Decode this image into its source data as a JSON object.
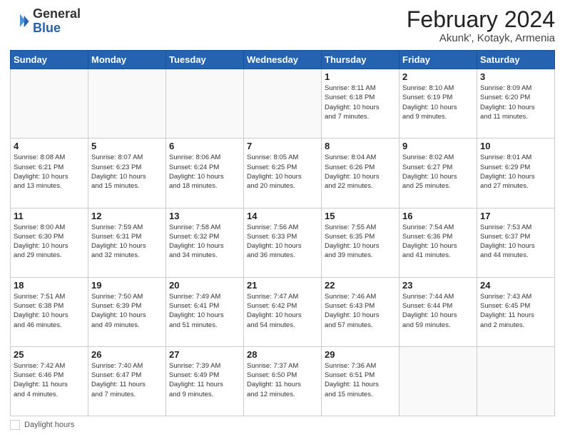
{
  "header": {
    "logo_general": "General",
    "logo_blue": "Blue",
    "month_title": "February 2024",
    "location": "Akunk', Kotayk, Armenia"
  },
  "days_of_week": [
    "Sunday",
    "Monday",
    "Tuesday",
    "Wednesday",
    "Thursday",
    "Friday",
    "Saturday"
  ],
  "footer": {
    "label": "Daylight hours"
  },
  "weeks": [
    [
      {
        "day": "",
        "info": ""
      },
      {
        "day": "",
        "info": ""
      },
      {
        "day": "",
        "info": ""
      },
      {
        "day": "",
        "info": ""
      },
      {
        "day": "1",
        "info": "Sunrise: 8:11 AM\nSunset: 6:18 PM\nDaylight: 10 hours\nand 7 minutes."
      },
      {
        "day": "2",
        "info": "Sunrise: 8:10 AM\nSunset: 6:19 PM\nDaylight: 10 hours\nand 9 minutes."
      },
      {
        "day": "3",
        "info": "Sunrise: 8:09 AM\nSunset: 6:20 PM\nDaylight: 10 hours\nand 11 minutes."
      }
    ],
    [
      {
        "day": "4",
        "info": "Sunrise: 8:08 AM\nSunset: 6:21 PM\nDaylight: 10 hours\nand 13 minutes."
      },
      {
        "day": "5",
        "info": "Sunrise: 8:07 AM\nSunset: 6:23 PM\nDaylight: 10 hours\nand 15 minutes."
      },
      {
        "day": "6",
        "info": "Sunrise: 8:06 AM\nSunset: 6:24 PM\nDaylight: 10 hours\nand 18 minutes."
      },
      {
        "day": "7",
        "info": "Sunrise: 8:05 AM\nSunset: 6:25 PM\nDaylight: 10 hours\nand 20 minutes."
      },
      {
        "day": "8",
        "info": "Sunrise: 8:04 AM\nSunset: 6:26 PM\nDaylight: 10 hours\nand 22 minutes."
      },
      {
        "day": "9",
        "info": "Sunrise: 8:02 AM\nSunset: 6:27 PM\nDaylight: 10 hours\nand 25 minutes."
      },
      {
        "day": "10",
        "info": "Sunrise: 8:01 AM\nSunset: 6:29 PM\nDaylight: 10 hours\nand 27 minutes."
      }
    ],
    [
      {
        "day": "11",
        "info": "Sunrise: 8:00 AM\nSunset: 6:30 PM\nDaylight: 10 hours\nand 29 minutes."
      },
      {
        "day": "12",
        "info": "Sunrise: 7:59 AM\nSunset: 6:31 PM\nDaylight: 10 hours\nand 32 minutes."
      },
      {
        "day": "13",
        "info": "Sunrise: 7:58 AM\nSunset: 6:32 PM\nDaylight: 10 hours\nand 34 minutes."
      },
      {
        "day": "14",
        "info": "Sunrise: 7:56 AM\nSunset: 6:33 PM\nDaylight: 10 hours\nand 36 minutes."
      },
      {
        "day": "15",
        "info": "Sunrise: 7:55 AM\nSunset: 6:35 PM\nDaylight: 10 hours\nand 39 minutes."
      },
      {
        "day": "16",
        "info": "Sunrise: 7:54 AM\nSunset: 6:36 PM\nDaylight: 10 hours\nand 41 minutes."
      },
      {
        "day": "17",
        "info": "Sunrise: 7:53 AM\nSunset: 6:37 PM\nDaylight: 10 hours\nand 44 minutes."
      }
    ],
    [
      {
        "day": "18",
        "info": "Sunrise: 7:51 AM\nSunset: 6:38 PM\nDaylight: 10 hours\nand 46 minutes."
      },
      {
        "day": "19",
        "info": "Sunrise: 7:50 AM\nSunset: 6:39 PM\nDaylight: 10 hours\nand 49 minutes."
      },
      {
        "day": "20",
        "info": "Sunrise: 7:49 AM\nSunset: 6:41 PM\nDaylight: 10 hours\nand 51 minutes."
      },
      {
        "day": "21",
        "info": "Sunrise: 7:47 AM\nSunset: 6:42 PM\nDaylight: 10 hours\nand 54 minutes."
      },
      {
        "day": "22",
        "info": "Sunrise: 7:46 AM\nSunset: 6:43 PM\nDaylight: 10 hours\nand 57 minutes."
      },
      {
        "day": "23",
        "info": "Sunrise: 7:44 AM\nSunset: 6:44 PM\nDaylight: 10 hours\nand 59 minutes."
      },
      {
        "day": "24",
        "info": "Sunrise: 7:43 AM\nSunset: 6:45 PM\nDaylight: 11 hours\nand 2 minutes."
      }
    ],
    [
      {
        "day": "25",
        "info": "Sunrise: 7:42 AM\nSunset: 6:46 PM\nDaylight: 11 hours\nand 4 minutes."
      },
      {
        "day": "26",
        "info": "Sunrise: 7:40 AM\nSunset: 6:47 PM\nDaylight: 11 hours\nand 7 minutes."
      },
      {
        "day": "27",
        "info": "Sunrise: 7:39 AM\nSunset: 6:49 PM\nDaylight: 11 hours\nand 9 minutes."
      },
      {
        "day": "28",
        "info": "Sunrise: 7:37 AM\nSunset: 6:50 PM\nDaylight: 11 hours\nand 12 minutes."
      },
      {
        "day": "29",
        "info": "Sunrise: 7:36 AM\nSunset: 6:51 PM\nDaylight: 11 hours\nand 15 minutes."
      },
      {
        "day": "",
        "info": ""
      },
      {
        "day": "",
        "info": ""
      }
    ]
  ]
}
